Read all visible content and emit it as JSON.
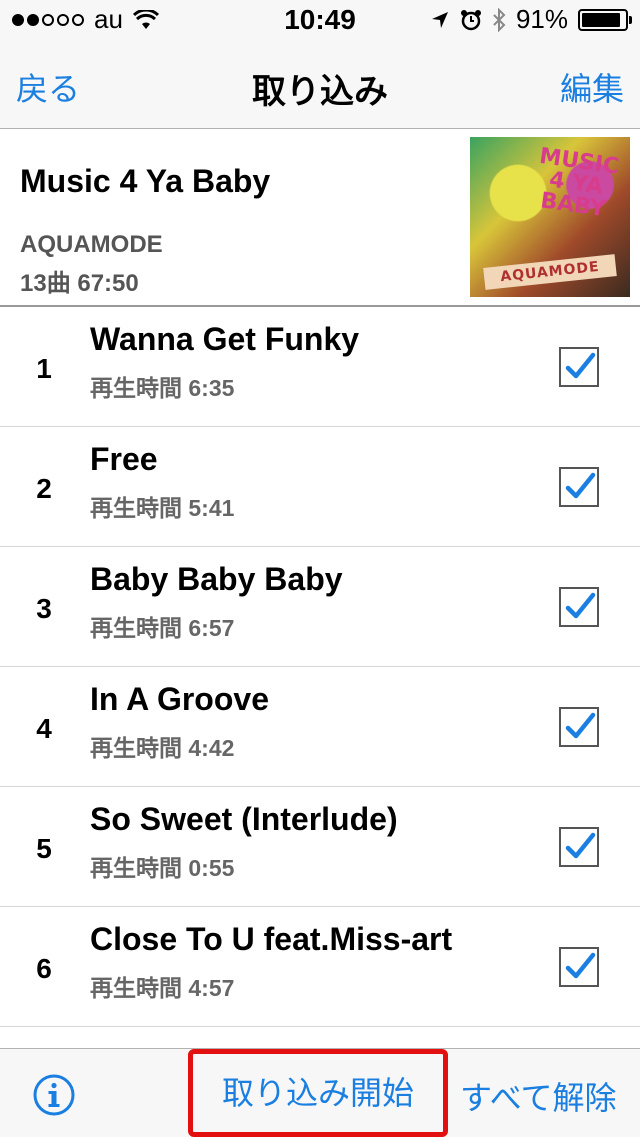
{
  "status_bar": {
    "carrier": "au",
    "time": "10:49",
    "battery_text": "91%",
    "battery_level": 0.91
  },
  "nav": {
    "back_label": "戻る",
    "title": "取り込み",
    "edit_label": "編集"
  },
  "album": {
    "title": "Music 4 Ya Baby",
    "artist": "AQUAMODE",
    "meta": "13曲 67:50",
    "cover_text": "MUSIC 4 YA BABY",
    "cover_band": "AQUAMODE"
  },
  "tracks": [
    {
      "no": "1",
      "name": "Wanna Get Funky",
      "duration": "再生時間 6:35",
      "checked": true
    },
    {
      "no": "2",
      "name": "Free",
      "duration": "再生時間 5:41",
      "checked": true
    },
    {
      "no": "3",
      "name": "Baby Baby Baby",
      "duration": "再生時間 6:57",
      "checked": true
    },
    {
      "no": "4",
      "name": "In A Groove",
      "duration": "再生時間 4:42",
      "checked": true
    },
    {
      "no": "5",
      "name": "So Sweet (Interlude)",
      "duration": "再生時間 0:55",
      "checked": true
    },
    {
      "no": "6",
      "name": "Close To U feat.Miss-art",
      "duration": "再生時間 4:57",
      "checked": true
    }
  ],
  "toolbar": {
    "start_label": "取り込み開始",
    "clear_label": "すべて解除"
  },
  "colors": {
    "accent": "#1a7fe0",
    "highlight": "#e21010"
  }
}
